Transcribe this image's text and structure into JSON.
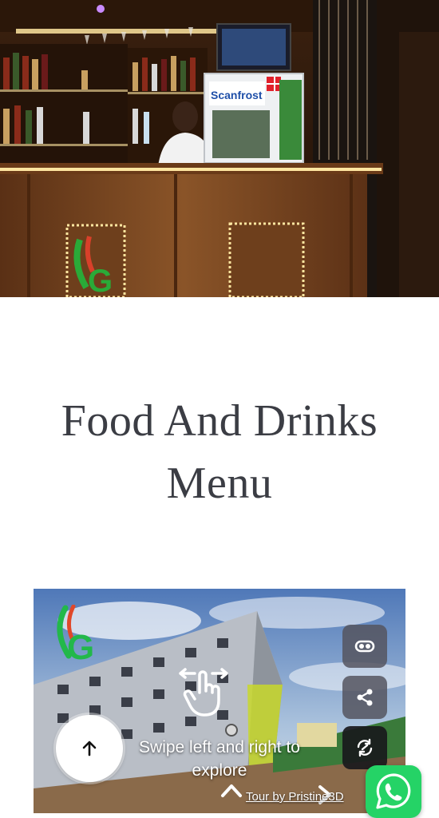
{
  "hero": {
    "fridge_brand": "Scanfrost",
    "description_icon": "bar-counter-photo"
  },
  "page": {
    "heading_line1": "Food And Drinks",
    "heading_line2": "Menu"
  },
  "tour": {
    "swipe_hint": "Swipe left and right to explore",
    "credit": "Tour by Pristine3D",
    "buttons": {
      "vr": "vr-headset-icon",
      "share": "share-icon",
      "autorotate": "autorotate-icon",
      "up": "arrow-up-icon"
    }
  },
  "floating": {
    "whatsapp": "whatsapp-icon"
  },
  "colors": {
    "heading": "#3b3d44",
    "whatsapp": "#25d366",
    "wood": "#7a4621",
    "led": "#ffe6a0"
  }
}
